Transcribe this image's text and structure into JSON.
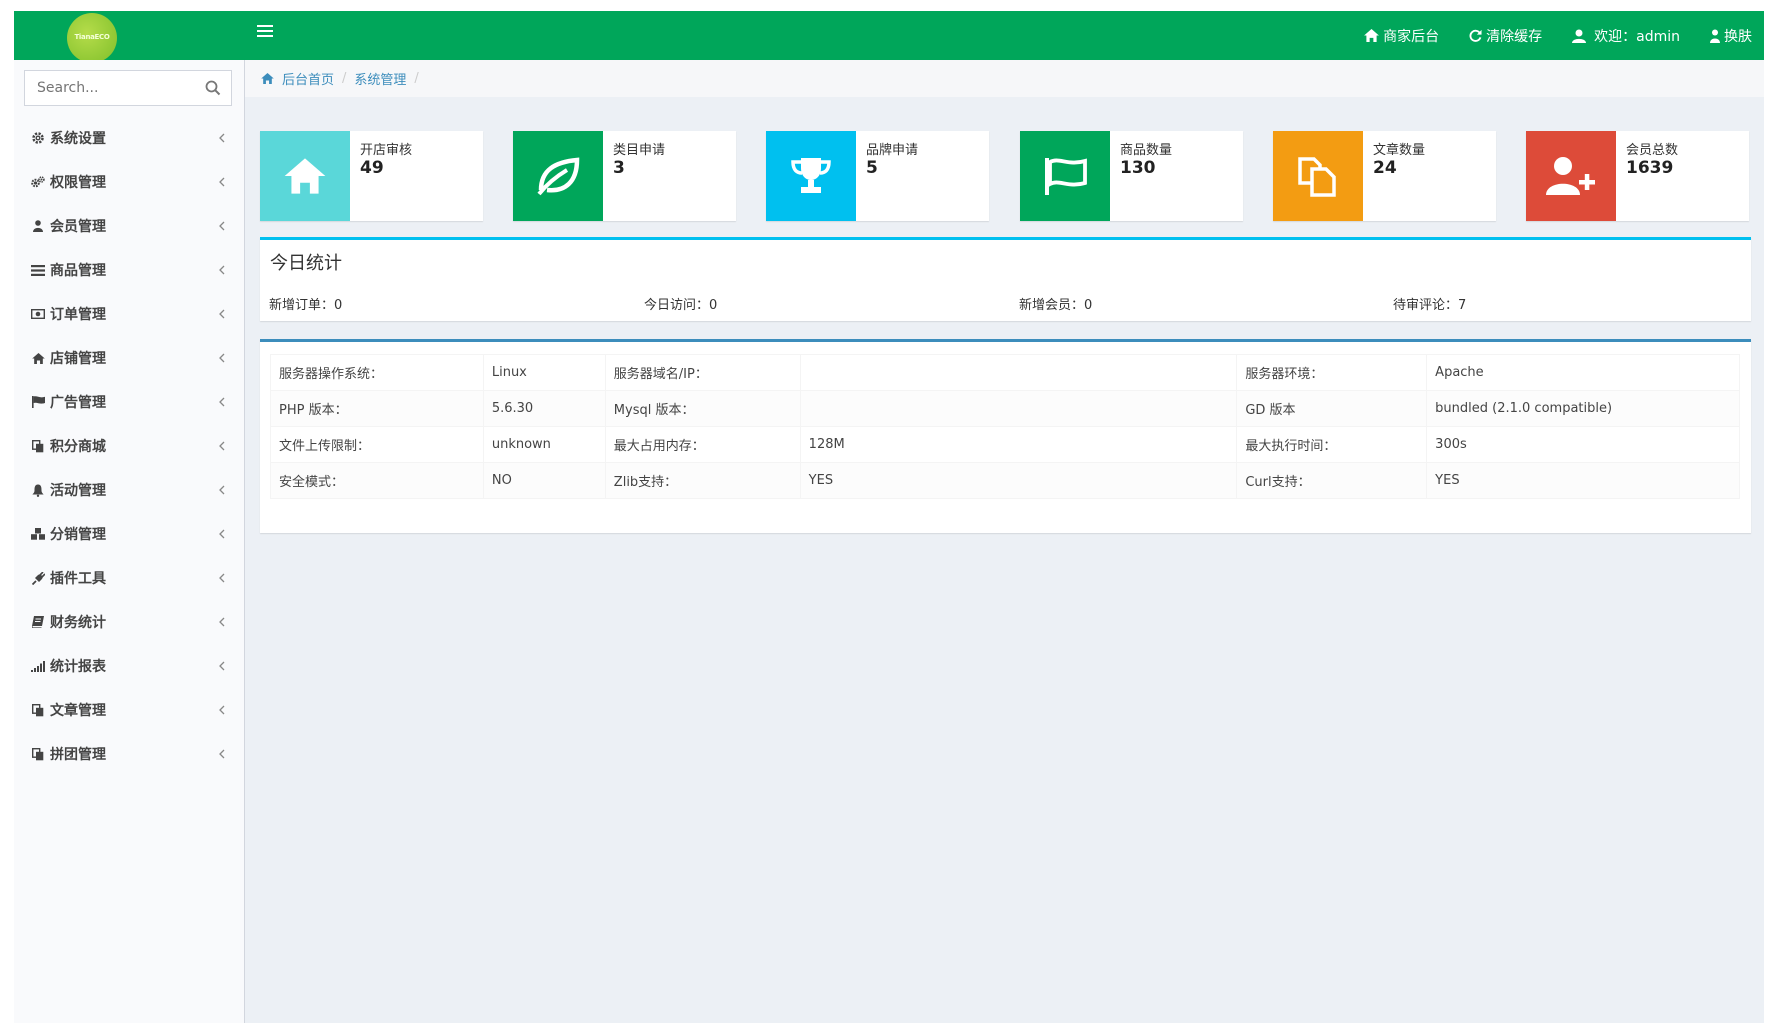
{
  "header": {
    "logo_text": "TianaECO",
    "nav": [
      {
        "label": "商家后台",
        "icon": "home-icon"
      },
      {
        "label": "清除缓存",
        "icon": "refresh-icon"
      },
      {
        "label": "欢迎：admin",
        "icon": "user-icon"
      },
      {
        "label": "换肤",
        "icon": "skin-icon"
      }
    ]
  },
  "sidebar": {
    "search_placeholder": "Search...",
    "items": [
      {
        "label": "系统设置",
        "icon": "gear-icon"
      },
      {
        "label": "权限管理",
        "icon": "gears-icon"
      },
      {
        "label": "会员管理",
        "icon": "user-icon"
      },
      {
        "label": "商品管理",
        "icon": "list-icon"
      },
      {
        "label": "订单管理",
        "icon": "money-icon"
      },
      {
        "label": "店铺管理",
        "icon": "home-icon"
      },
      {
        "label": "广告管理",
        "icon": "flag-icon"
      },
      {
        "label": "积分商城",
        "icon": "copy-icon"
      },
      {
        "label": "活动管理",
        "icon": "bell-icon"
      },
      {
        "label": "分销管理",
        "icon": "cubes-icon"
      },
      {
        "label": "插件工具",
        "icon": "plug-icon"
      },
      {
        "label": "财务统计",
        "icon": "book-icon"
      },
      {
        "label": "统计报表",
        "icon": "signal-icon"
      },
      {
        "label": "文章管理",
        "icon": "copy-icon"
      },
      {
        "label": "拼团管理",
        "icon": "copy-icon"
      }
    ]
  },
  "breadcrumb": [
    "后台首页",
    "系统管理"
  ],
  "info_boxes": [
    {
      "label": "开店审核",
      "value": "49",
      "color": "#5ad7d9",
      "icon": "home-icon"
    },
    {
      "label": "类目申请",
      "value": "3",
      "color": "#00a65a",
      "icon": "leaf-icon"
    },
    {
      "label": "品牌申请",
      "value": "5",
      "color": "#00c0ef",
      "icon": "trophy-icon"
    },
    {
      "label": "商品数量",
      "value": "130",
      "color": "#00a65a",
      "icon": "flag-icon"
    },
    {
      "label": "文章数量",
      "value": "24",
      "color": "#f39c12",
      "icon": "copy-icon"
    },
    {
      "label": "会员总数",
      "value": "1639",
      "color": "#dd4b39",
      "icon": "user-plus-icon"
    }
  ],
  "today": {
    "title": "今日统计",
    "stats": [
      "新增订单：0",
      "今日访问：0",
      "新增会员：0",
      "待审评论：7"
    ]
  },
  "server": {
    "rows": [
      [
        "服务器操作系统：",
        "Linux",
        "服务器域名/IP：",
        "",
        "服务器环境：",
        "Apache"
      ],
      [
        "PHP 版本：",
        "5.6.30",
        "Mysql 版本：",
        "",
        "GD 版本",
        "bundled (2.1.0 compatible)"
      ],
      [
        "文件上传限制：",
        "unknown",
        "最大占用内存：",
        "128M",
        "最大执行时间：",
        "300s"
      ],
      [
        "安全模式：",
        "NO",
        "Zlib支持：",
        "YES",
        "Curl支持：",
        "YES"
      ]
    ]
  }
}
